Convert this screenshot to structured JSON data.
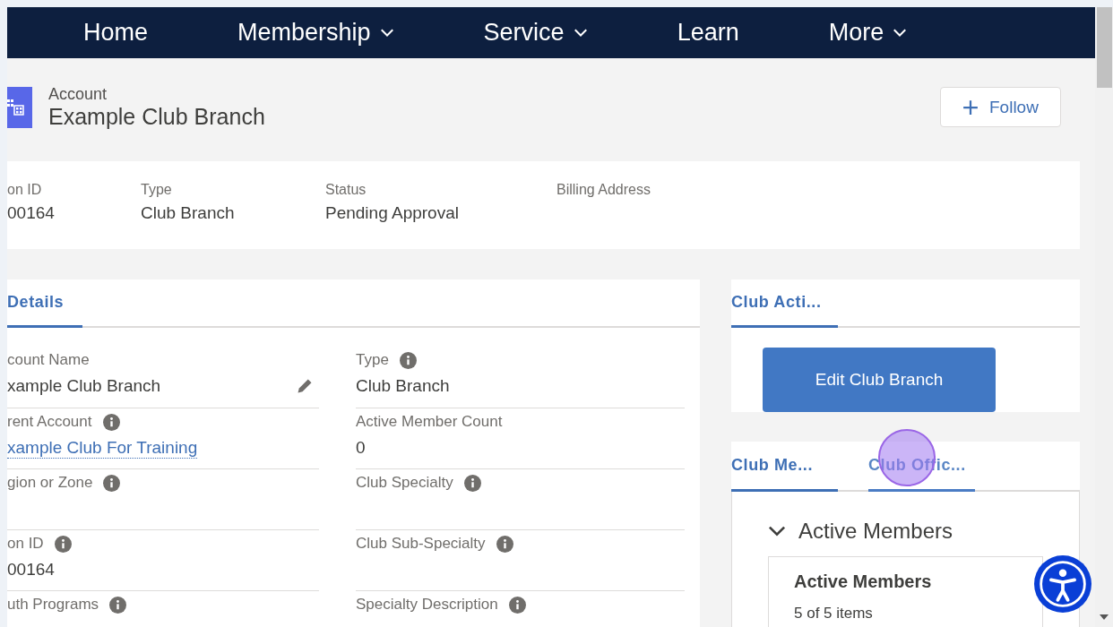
{
  "nav": [
    {
      "label": "Home",
      "has_menu": false
    },
    {
      "label": "Membership",
      "has_menu": true
    },
    {
      "label": "Service",
      "has_menu": true
    },
    {
      "label": "Learn",
      "has_menu": false
    },
    {
      "label": "More",
      "has_menu": true
    }
  ],
  "record": {
    "object_label": "Account",
    "title": "Example Club Branch",
    "follow_button": "Follow"
  },
  "highlights": [
    {
      "label": "on ID",
      "value": "00164"
    },
    {
      "label": "Type",
      "value": "Club Branch"
    },
    {
      "label": "Status",
      "value": "Pending Approval"
    },
    {
      "label": "Billing Address"
    }
  ],
  "details": {
    "tabs": [
      {
        "label": "Details",
        "selected": true
      }
    ],
    "fields": [
      {
        "label": "count Name",
        "value": "xample Club Branch",
        "info": false,
        "editable": true,
        "link": false
      },
      {
        "label": "Type",
        "value": "Club Branch",
        "info": true,
        "editable": false,
        "link": false
      },
      {
        "label": "rent Account",
        "value": "xample Club For Training",
        "info": true,
        "editable": false,
        "link": true
      },
      {
        "label": "Active Member Count",
        "value": "0",
        "info": false,
        "editable": false,
        "link": false
      },
      {
        "label": "gion or Zone",
        "info": true,
        "editable": false
      },
      {
        "label": "Club Specialty",
        "info": true,
        "editable": false
      },
      {
        "label": "on ID",
        "value": "00164",
        "info": true,
        "editable": false,
        "link": false
      },
      {
        "label": "Club Sub-Specialty",
        "info": true,
        "editable": false
      },
      {
        "label": "uth Programs",
        "info": true,
        "editable": false
      },
      {
        "label": "Specialty Description",
        "info": true,
        "editable": false
      }
    ]
  },
  "actions": {
    "tabs": [
      {
        "label": "Club Acti...",
        "selected": true
      }
    ],
    "button": "Edit Club Branch"
  },
  "related": {
    "tabs": [
      {
        "label": "Club Me...",
        "selected": true,
        "hovered": false
      },
      {
        "label": "Club Offic...",
        "selected": false,
        "hovered": true
      }
    ],
    "section": {
      "title": "Active Members",
      "expanded": true
    },
    "list_card": {
      "title": "Active Members",
      "count": "5 of 5 items"
    }
  }
}
